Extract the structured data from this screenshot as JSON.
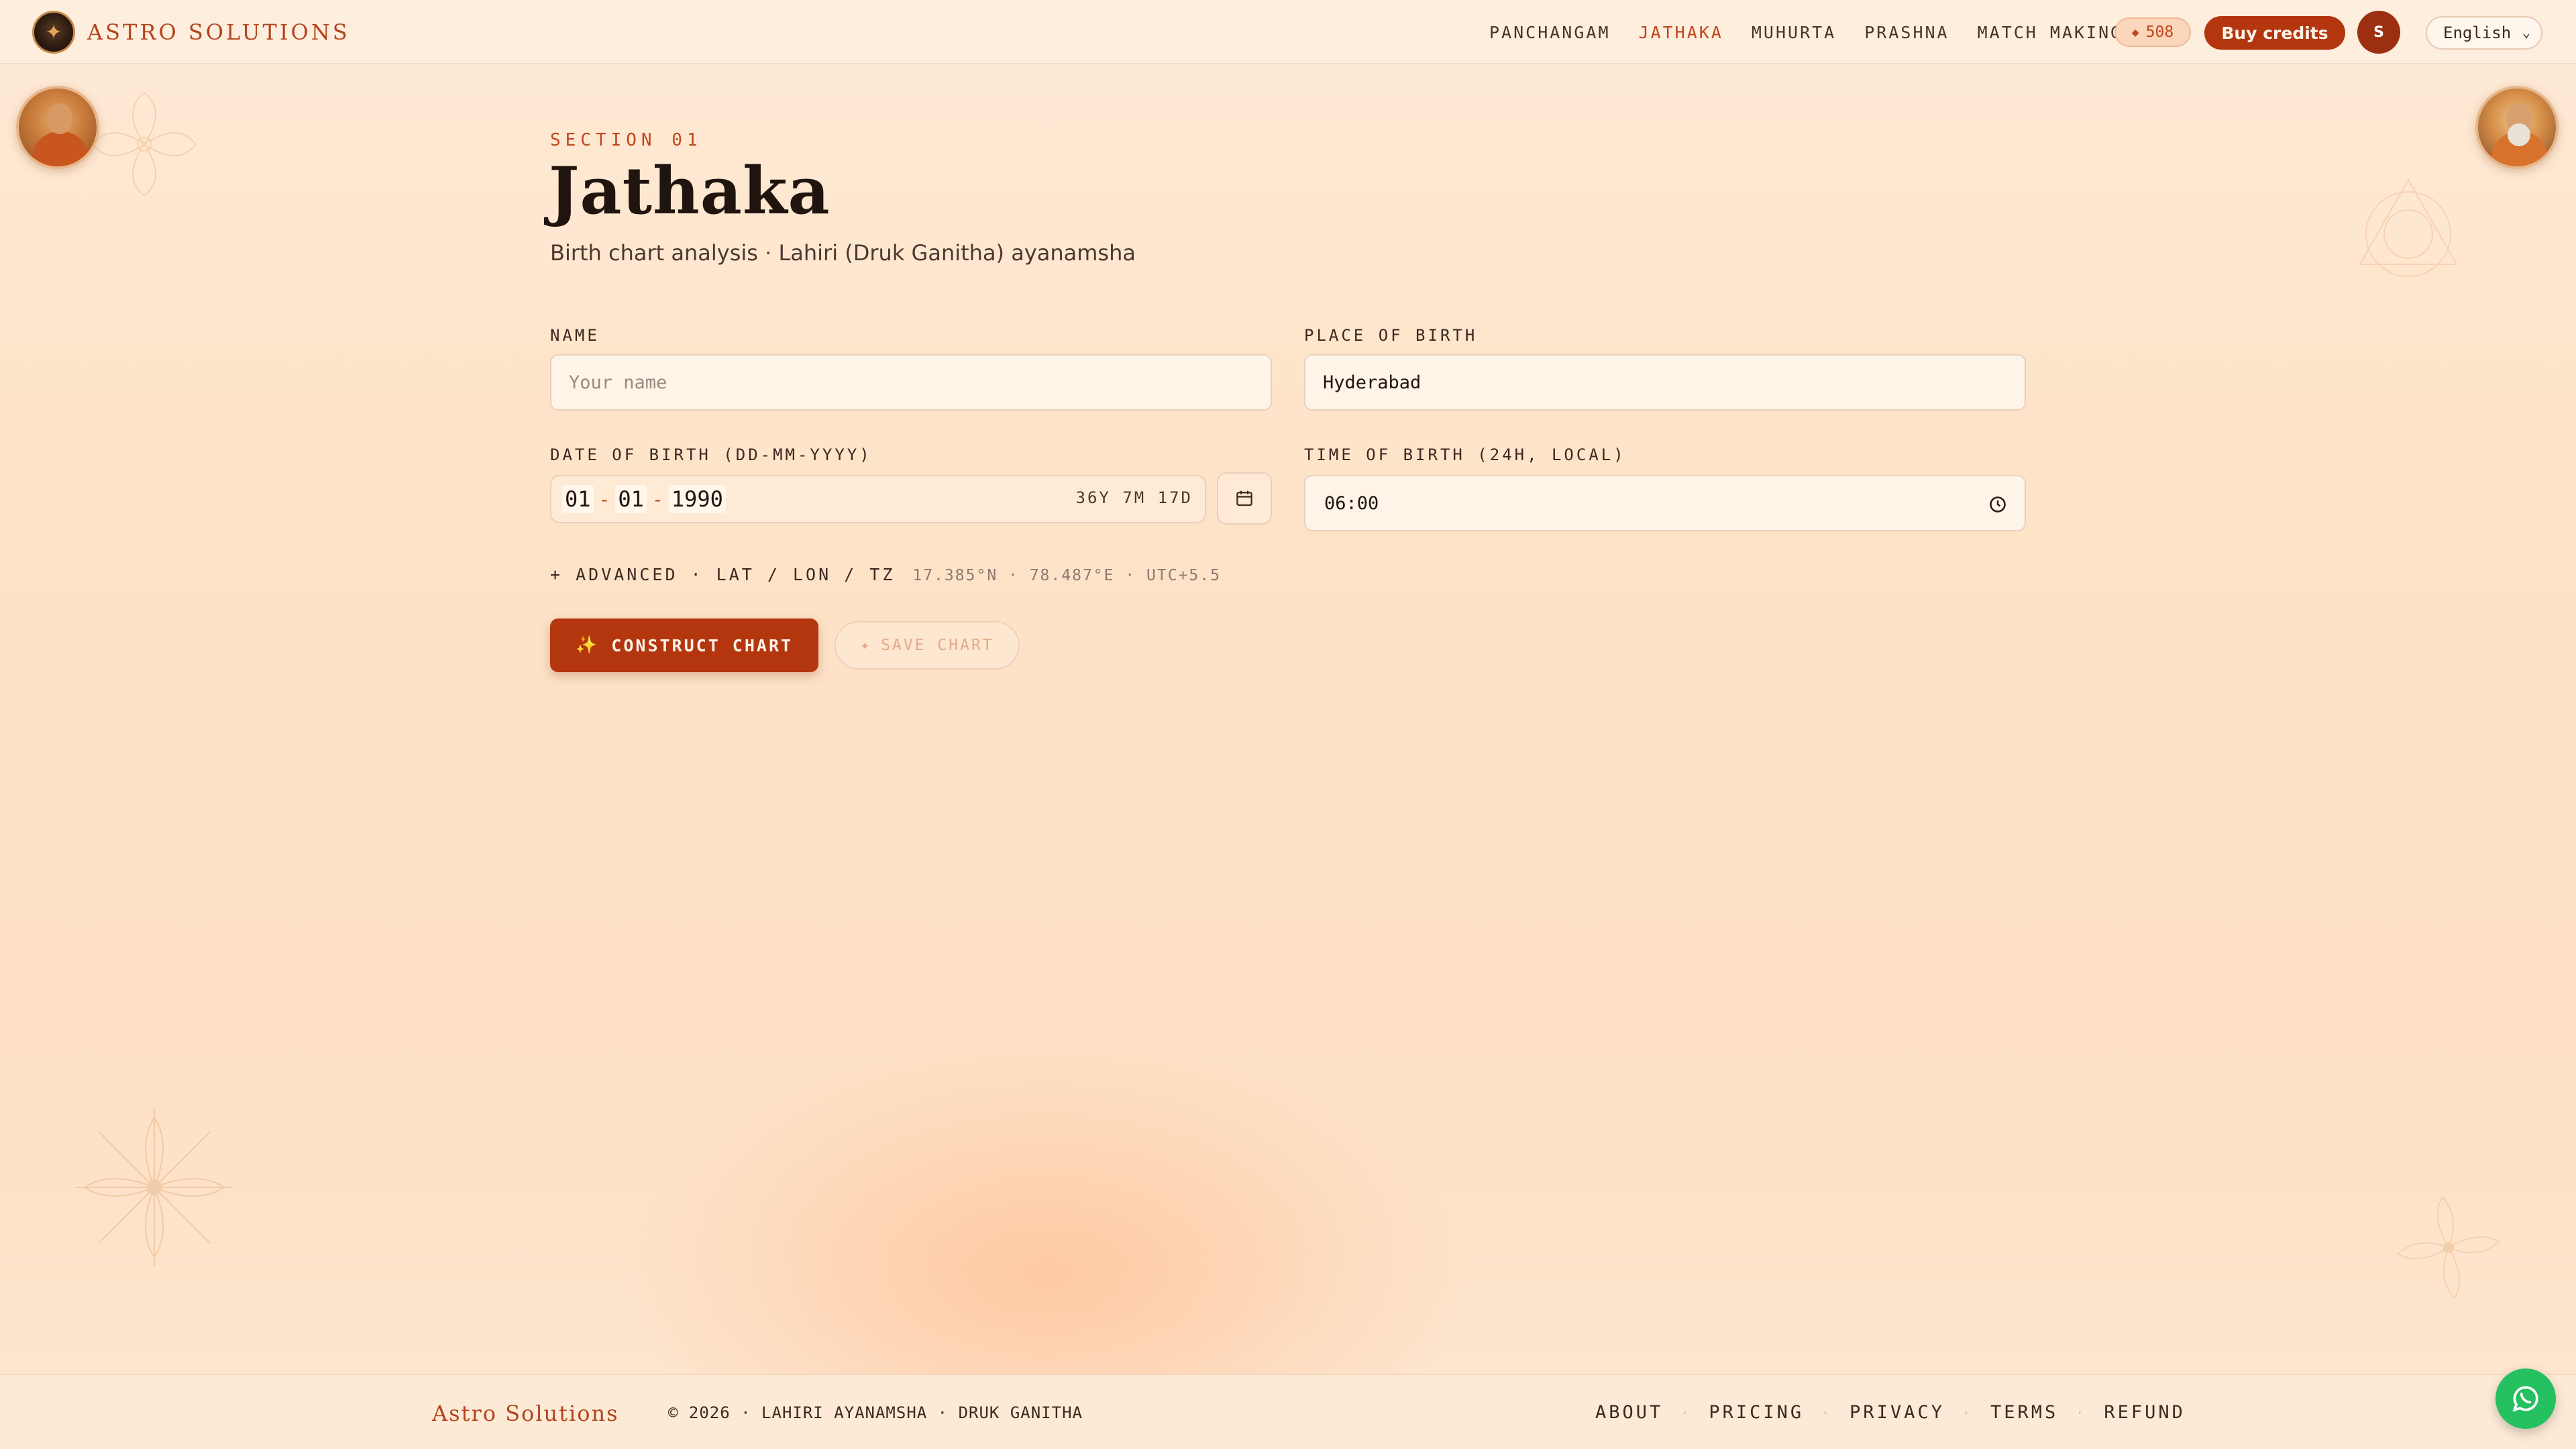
{
  "brand": {
    "name": "ASTRO SOLUTIONS"
  },
  "nav": {
    "items": [
      {
        "label": "PANCHANGAM",
        "active": false
      },
      {
        "label": "JATHAKA",
        "active": true
      },
      {
        "label": "MUHURTA",
        "active": false
      },
      {
        "label": "PRASHNA",
        "active": false
      },
      {
        "label": "MATCH MAKING",
        "active": false
      }
    ],
    "credits": "508",
    "credits_icon": "diamond-icon",
    "buy_credits_label": "Buy credits",
    "user_initial": "S",
    "language": "English"
  },
  "page": {
    "eyebrow": "SECTION 01",
    "title": "Jathaka",
    "subtitle": "Birth chart analysis · Lahiri (Druk Ganitha) ayanamsha"
  },
  "form": {
    "name_label": "NAME",
    "name_placeholder": "Your name",
    "name_value": "",
    "place_label": "PLACE OF BIRTH",
    "place_value": "Hyderabad",
    "dob_label": "DATE OF BIRTH (DD-MM-YYYY)",
    "dob_day": "01",
    "dob_month": "01",
    "dob_year": "1990",
    "dob_separator": "-",
    "dob_age": "36Y 7M 17D",
    "tob_label": "TIME OF BIRTH (24H, LOCAL)",
    "tob_value": "06:00",
    "advanced_label": "+ ADVANCED · LAT / LON / TZ",
    "advanced_coords": "17.385°N · 78.487°E · UTC+5.5",
    "construct_label": "CONSTRUCT CHART",
    "save_label": "SAVE CHART"
  },
  "footer": {
    "brand": "Astro Solutions",
    "copyright": "© 2026 · LAHIRI AYANAMSHA · DRUK GANITHA",
    "links": [
      "ABOUT",
      "PRICING",
      "PRIVACY",
      "TERMS",
      "REFUND"
    ]
  },
  "colors": {
    "accent": "#b3360f",
    "brand_text": "#b3441e",
    "active_nav": "#c2461c",
    "background": "#fde3c8",
    "whatsapp": "#25c05f"
  }
}
